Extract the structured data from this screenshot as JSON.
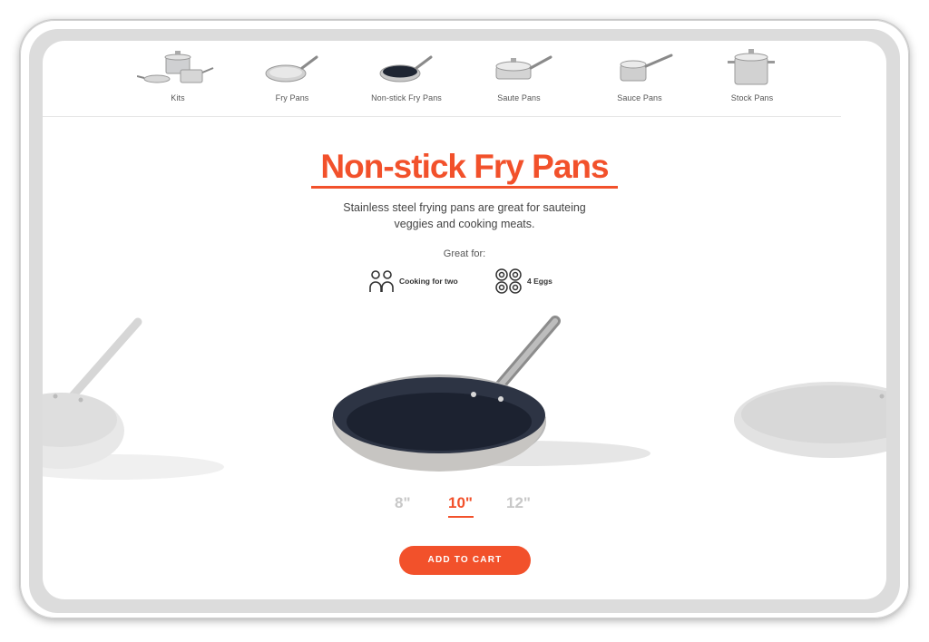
{
  "nav": {
    "items": [
      {
        "label": "Kits",
        "icon": "cookware-kit-icon"
      },
      {
        "label": "Fry Pans",
        "icon": "fry-pan-icon"
      },
      {
        "label": "Non-stick Fry Pans",
        "icon": "non-stick-fry-pan-icon"
      },
      {
        "label": "Saute Pans",
        "icon": "saute-pan-icon"
      },
      {
        "label": "Sauce Pans",
        "icon": "sauce-pan-icon"
      },
      {
        "label": "Stock Pans",
        "icon": "stock-pan-icon"
      }
    ]
  },
  "product": {
    "title": "Non-stick Fry Pans",
    "description": "Stainless steel frying pans are great for sauteing veggies and cooking meats.",
    "great_for_label": "Great for:",
    "features": [
      {
        "label": "Cooking for two",
        "icon": "two-people-icon"
      },
      {
        "label": "4 Eggs",
        "icon": "eggs-icon"
      }
    ],
    "sizes": [
      "8\"",
      "10\"",
      "12\""
    ],
    "selected_size": "10\"",
    "add_to_cart": "ADD TO CART"
  },
  "colors": {
    "accent": "#f2512b",
    "size_inactive": "#c8c8c8"
  }
}
